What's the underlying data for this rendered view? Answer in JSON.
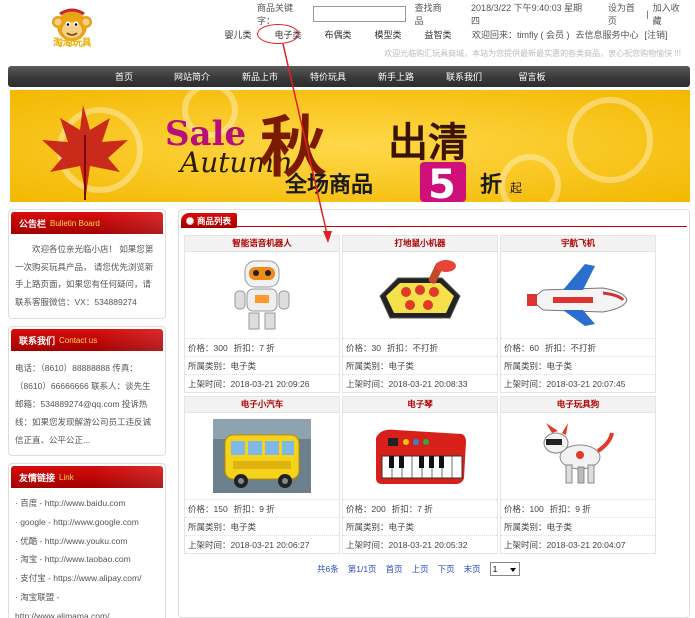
{
  "header": {
    "logo_alt": "logo",
    "logo_text": "淘淘玩具",
    "keyword_label": "商品关键字：",
    "keyword_value": "",
    "search_link": "查找商品",
    "datetime": "2018/3/22 下午9:40:03 星期四",
    "set_home": "设为首页",
    "separator": "|",
    "add_favorite": "加入收藏",
    "categories": [
      "婴儿类",
      "电子类",
      "布偶类",
      "模型类",
      "益智类"
    ],
    "welcome": "欢迎回来：timfly ( 会员 )",
    "info_center": "去信息服务中心",
    "logout": "[注销]",
    "marquee": "欢迎光临购汇玩具商城，本站为您提供最新最实惠的各类商品，衷心祝您购物愉快 !!!"
  },
  "mainnav": {
    "items": [
      "首页",
      "网站简介",
      "新品上市",
      "特价玩具",
      "新手上路",
      "联系我们",
      "留言板"
    ]
  },
  "banner": {
    "sale": "Sale",
    "autumn": "Autumn",
    "char_qiu": "秋",
    "chuqing": "出清",
    "quanchang": "全场商品",
    "five": "5",
    "zhe": "折",
    "qi": "起"
  },
  "sidebar": {
    "bulletin": {
      "title": "公告栏",
      "en": "Bulletin Board",
      "text": "欢迎各位亲光临小店！ 如果您第一次购买玩具产品， 请您优先浏览新手上路页面，如果您有任何疑问，请联系客服微信：VX：534889274"
    },
    "contact": {
      "title": "联系我们",
      "en": "Contact us",
      "text": "电话：（8610）88888888 传真：（8610）66666666 联系人：谈先生 邮箱：534889274@qq.com 投诉热线：如果您发现解游公司员工违反诚信正直、公平公正..."
    },
    "links": {
      "title": "友情链接",
      "en": "Link",
      "items": [
        "· 百度 - http://www.baidu.com",
        "· google - http://www.google.com",
        "· 优酷 - http://www.youku.com",
        "· 淘宝 - http://www.taobao.com",
        "· 支付宝 - https://www.alipay.com/",
        "· 淘宝联盟 -",
        "http://www.alimama.com/"
      ]
    }
  },
  "products": {
    "title": "商品列表",
    "labels": {
      "price": "价格：",
      "discount": "折扣：",
      "category": "所属类别：",
      "listed": "上架时间："
    },
    "items": [
      {
        "name": "智能语音机器人",
        "price": "300",
        "discount": "7 折",
        "category": "电子类",
        "listed": "2018-03-21 20:09:26",
        "icon": "robot-image"
      },
      {
        "name": "打地鼠小机器",
        "price": "30",
        "discount": "不打折",
        "category": "电子类",
        "listed": "2018-03-21 20:08:33",
        "icon": "whack-a-mole-image"
      },
      {
        "name": "宇航飞机",
        "price": "60",
        "discount": "不打折",
        "category": "电子类",
        "listed": "2018-03-21 20:07:45",
        "icon": "space-shuttle-image"
      },
      {
        "name": "电子小汽车",
        "price": "150",
        "discount": "9 折",
        "category": "电子类",
        "listed": "2018-03-21 20:06:27",
        "icon": "toy-bus-image"
      },
      {
        "name": "电子琴",
        "price": "200",
        "discount": "7 折",
        "category": "电子类",
        "listed": "2018-03-21 20:05:32",
        "icon": "keyboard-image"
      },
      {
        "name": "电子玩具狗",
        "price": "100",
        "discount": "9 折",
        "category": "电子类",
        "listed": "2018-03-21 20:04:07",
        "icon": "robot-dog-image"
      }
    ],
    "pager": {
      "total": "共6条",
      "page": "第1/1页",
      "first": "首页",
      "prev": "上页",
      "next": "下页",
      "last": "末页",
      "select_value": "1"
    }
  },
  "colors": {
    "accent_red": "#c10000",
    "nav_dark": "#3a3a3a",
    "banner_yellow": "#f6c500",
    "link_blue": "#2a4fbf",
    "annotation_red": "#e02020"
  }
}
